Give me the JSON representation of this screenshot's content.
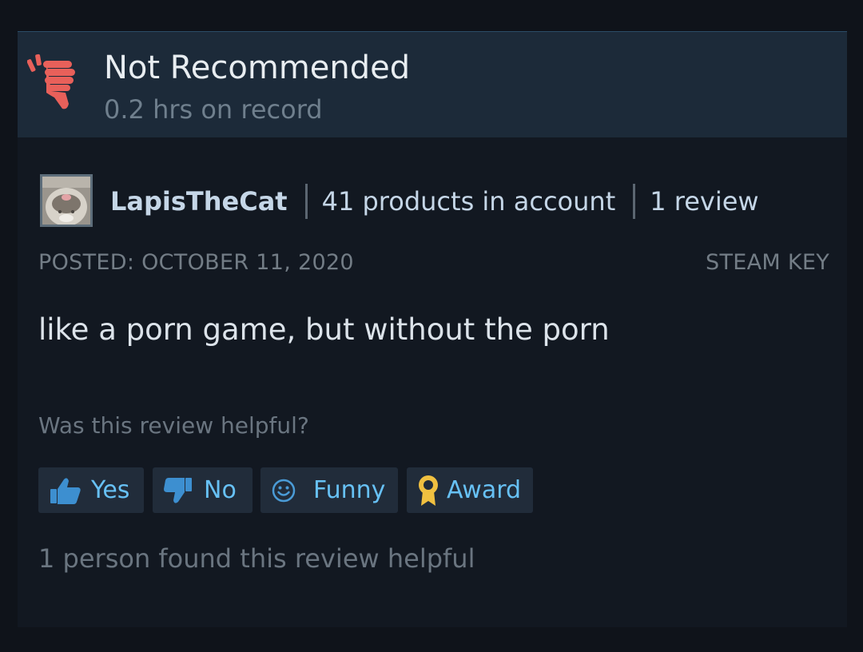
{
  "recommendation": {
    "title": "Not Recommended",
    "hours": "0.2 hrs on record",
    "icon": "thumbs-down-icon",
    "icon_color": "#e8605a"
  },
  "author": {
    "name": "LapisTheCat",
    "products": "41 products in account",
    "reviews": "1 review"
  },
  "meta": {
    "posted": "POSTED: OCTOBER 11, 2020",
    "source": "STEAM KEY"
  },
  "review": {
    "text": "like a porn game, but without the porn"
  },
  "feedback": {
    "question": "Was this review helpful?",
    "buttons": {
      "yes": "Yes",
      "no": "No",
      "funny": "Funny",
      "award": "Award"
    },
    "helpful_count_text": "1 person found this review helpful"
  },
  "colors": {
    "accent": "#67c1f5",
    "header_bg": "#1c2a39",
    "body_bg": "#121821"
  }
}
